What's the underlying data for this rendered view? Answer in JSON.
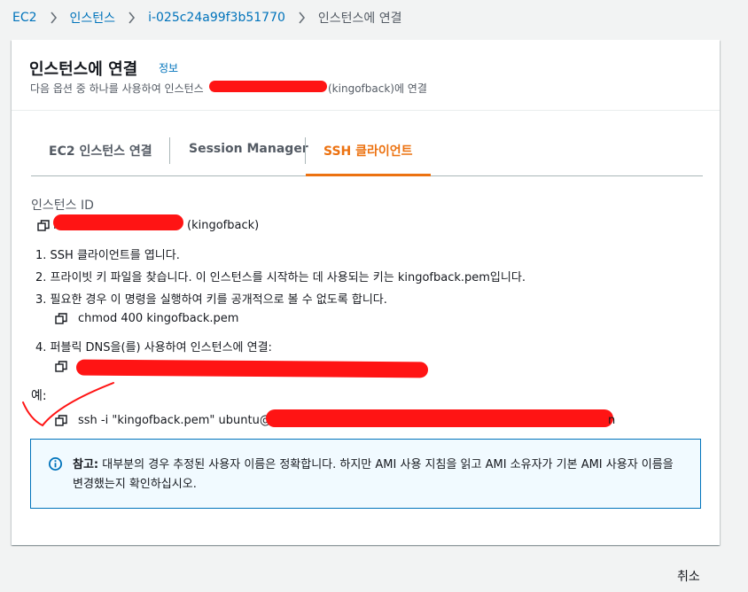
{
  "breadcrumb": {
    "items": [
      "EC2",
      "인스턴스",
      "i-025c24a99f3b51770"
    ],
    "current": "인스턴스에 연결"
  },
  "header": {
    "title": "인스턴스에 연결",
    "info_link": "정보",
    "description_prefix": "다음 옵션 중 하나를 사용하여 인스턴스",
    "description_suffix": "(kingofback)에 연결"
  },
  "tabs": [
    {
      "label": "EC2 인스턴스 연결",
      "active": false
    },
    {
      "label": "Session Manager",
      "active": false
    },
    {
      "label": "SSH 클라이언트",
      "active": true
    }
  ],
  "instance": {
    "id_label": "인스턴스 ID",
    "id_suffix": "(kingofback)",
    "id_prefix": "i"
  },
  "steps": [
    "1. SSH 클라이언트를 엽니다.",
    "2. 프라이빗 키 파일을 찾습니다. 이 인스턴스를 시작하는 데 사용되는 키는 kingofback.pem입니다.",
    "3. 필요한 경우 이 명령을 실행하여 키를 공개적으로 볼 수 없도록 합니다.",
    "4. 퍼블릭 DNS을(를) 사용하여 인스턴스에 연결:"
  ],
  "chmod_command": "chmod 400 kingofback.pem",
  "example": {
    "label": "예:",
    "command_prefix": "ssh -i \"kingofback.pem\" ubuntu@",
    "command_suffix": "n"
  },
  "note": {
    "label": "참고:",
    "text": "대부분의 경우 추정된 사용자 이름은 정확합니다. 하지만 AMI 사용 지침을 읽고 AMI 소유자가 기본 AMI 사용자 이름을 변경했는지 확인하십시오."
  },
  "cancel_label": "취소",
  "colors": {
    "link": "#0073bb",
    "accent": "#ec7211",
    "redaction": "#ff1414",
    "info_bg": "#f1faff"
  },
  "icons": [
    "chevron-right-icon",
    "copy-icon",
    "info-icon"
  ]
}
